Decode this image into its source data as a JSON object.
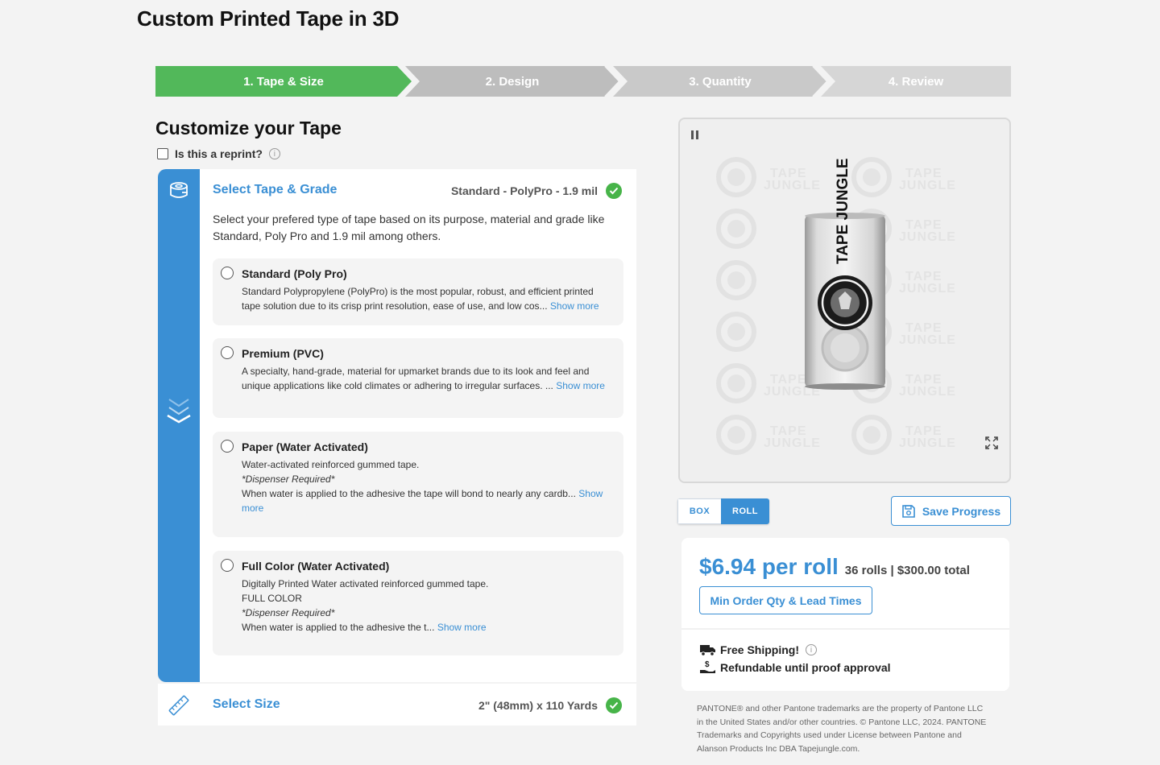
{
  "page": {
    "title": "Custom Printed Tape in 3D"
  },
  "steps": [
    {
      "label": "1. Tape & Size",
      "state": "active"
    },
    {
      "label": "2. Design",
      "state": "inactive"
    },
    {
      "label": "3. Quantity",
      "state": "inactive"
    },
    {
      "label": "4. Review",
      "state": "inactive"
    }
  ],
  "colors": {
    "accent": "#3a8fd4",
    "success": "#47b449",
    "step_active": "#52b85a",
    "step_inactive": "#bdbdbd"
  },
  "customize": {
    "title": "Customize your Tape",
    "reprint_label": "Is this a reprint?"
  },
  "tape_section": {
    "title": "Select Tape & Grade",
    "value": "Standard - PolyPro - 1.9 mil",
    "description": "Select your prefered type of tape based on its purpose, material and grade like Standard, Poly Pro and 1.9 mil among others.",
    "options": [
      {
        "title": "Standard (Poly Pro)",
        "body": "Standard Polypropylene (PolyPro) is the most popular, robust, and efficient printed tape solution due to its crisp print resolution, ease of use, and low cos...",
        "show_more": "Show more"
      },
      {
        "title": "Premium (PVC)",
        "body": "A specialty, hand-grade, material for upmarket brands due to its look and feel and unique applications like cold climates or adhering to irregular surfaces. ...",
        "show_more": "Show more"
      },
      {
        "title": "Paper (Water Activated)",
        "line1": "Water-activated reinforced gummed tape.",
        "line2": "*Dispenser Required*",
        "body": "When water is applied to the adhesive the tape will bond to nearly any cardb...",
        "show_more": "Show more"
      },
      {
        "title": "Full Color (Water Activated)",
        "line1": "Digitally Printed Water activated reinforced gummed tape.",
        "line2": "FULL COLOR",
        "line3": "*Dispenser Required*",
        "body": "When water is applied to the adhesive the t...",
        "show_more": "Show more"
      }
    ]
  },
  "size_section": {
    "title": "Select Size",
    "value": "2\" (48mm) x 110 Yards"
  },
  "preview": {
    "watermark_line1": "TAPE",
    "watermark_line2": "JUNGLE",
    "tape_text": "TAPE JUNGLE"
  },
  "view_toggle": {
    "box_label": "BOX",
    "roll_label": "ROLL",
    "selected": "ROLL"
  },
  "save_button": {
    "label": "Save Progress"
  },
  "pricing": {
    "price": "$6.94 per roll",
    "summary": "36 rolls | $300.00 total",
    "min_order_button": "Min Order Qty & Lead Times",
    "free_shipping": "Free Shipping!",
    "refundable": "Refundable until proof approval"
  },
  "legal": {
    "pantone_notice": "PANTONE® and other Pantone trademarks are the property of Pantone LLC in the United States and/or other countries. © Pantone LLC, 2024. PANTONE Trademarks and Copyrights used under License between Pantone and Alanson Products Inc DBA Tapejungle.com."
  }
}
